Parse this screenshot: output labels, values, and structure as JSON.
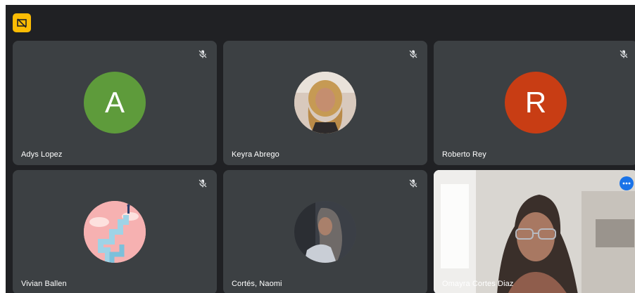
{
  "toolbar": {
    "icon": "presentation-off-icon"
  },
  "participants": [
    {
      "name": "Adys Lopez",
      "avatar_type": "initial",
      "initial": "A",
      "avatar_color": "#5e9b3b",
      "muted": true
    },
    {
      "name": "Keyra Abrego",
      "avatar_type": "photo",
      "muted": true
    },
    {
      "name": "Roberto Rey",
      "avatar_type": "initial",
      "initial": "R",
      "avatar_color": "#c83d14",
      "muted": true
    },
    {
      "name": "Vivian Ballen",
      "avatar_type": "illustration",
      "muted": true
    },
    {
      "name": "Cortés, Naomi",
      "avatar_type": "photo",
      "muted": true
    },
    {
      "name": "Omayra Cortes Diaz",
      "avatar_type": "video",
      "muted": false,
      "active_speaker": true
    }
  ],
  "colors": {
    "background": "#202124",
    "tile": "#3c4043",
    "active_border": "#8ab4f8",
    "accent": "#fbbc04"
  }
}
